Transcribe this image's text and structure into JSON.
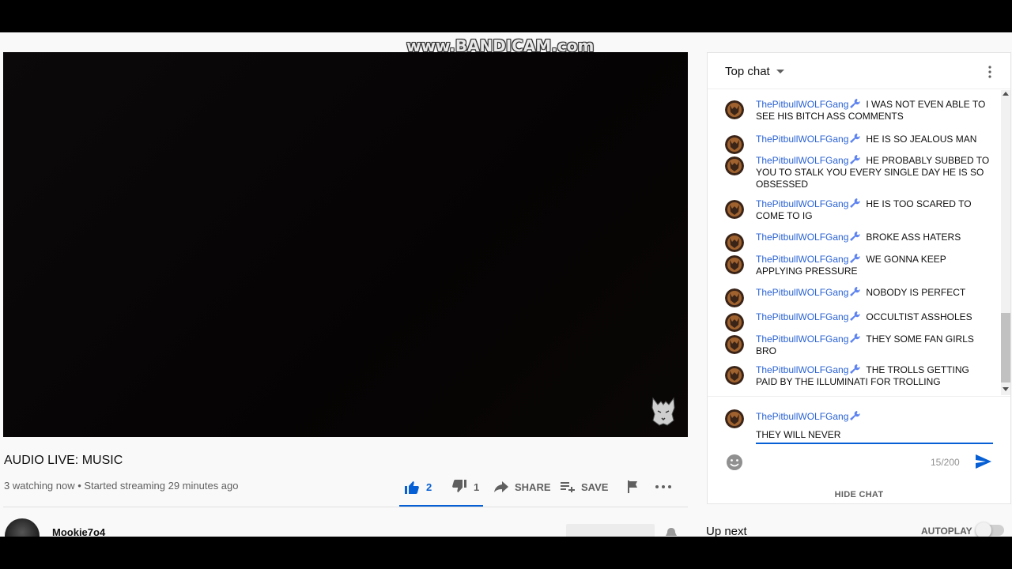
{
  "watermark": "www.BANDICAM.com",
  "video": {
    "title": "AUDIO LIVE: MUSIC",
    "meta": "3 watching now • Started streaming 29 minutes ago"
  },
  "actions": {
    "likes": "2",
    "dislikes": "1",
    "share": "SHARE",
    "save": "SAVE"
  },
  "channel": {
    "name": "Mookie7o4"
  },
  "chat": {
    "mode": "Top chat",
    "messages": [
      {
        "author": "ThePitbullWOLFGang",
        "text": "I WAS NOT EVEN ABLE TO SEE HIS BITCH ASS COMMENTS"
      },
      {
        "author": "ThePitbullWOLFGang",
        "text": "HE IS SO JEALOUS MAN"
      },
      {
        "author": "ThePitbullWOLFGang",
        "text": "HE PROBABLY SUBBED TO YOU TO STALK YOU EVERY SINGLE DAY HE IS SO OBSESSED"
      },
      {
        "author": "ThePitbullWOLFGang",
        "text": "HE IS TOO SCARED TO COME TO IG"
      },
      {
        "author": "ThePitbullWOLFGang",
        "text": "BROKE ASS HATERS"
      },
      {
        "author": "ThePitbullWOLFGang",
        "text": "WE GONNA KEEP APPLYING PRESSURE"
      },
      {
        "author": "ThePitbullWOLFGang",
        "text": "NOBODY IS PERFECT"
      },
      {
        "author": "ThePitbullWOLFGang",
        "text": "OCCULTIST ASSHOLES"
      },
      {
        "author": "ThePitbullWOLFGang",
        "text": "THEY SOME FAN GIRLS BRO"
      },
      {
        "author": "ThePitbullWOLFGang",
        "text": "THE TROLLS GETTING PAID BY THE ILLUMINATI FOR TROLLING"
      }
    ],
    "composer": {
      "author": "ThePitbullWOLFGang",
      "value": "THEY WILL NEVER",
      "counter": "15/200"
    },
    "hide_chat": "HIDE CHAT"
  },
  "sidebar": {
    "up_next": "Up next",
    "autoplay": "AUTOPLAY"
  },
  "colors": {
    "link_blue": "#2962d4",
    "accent_blue": "#065fd4"
  }
}
